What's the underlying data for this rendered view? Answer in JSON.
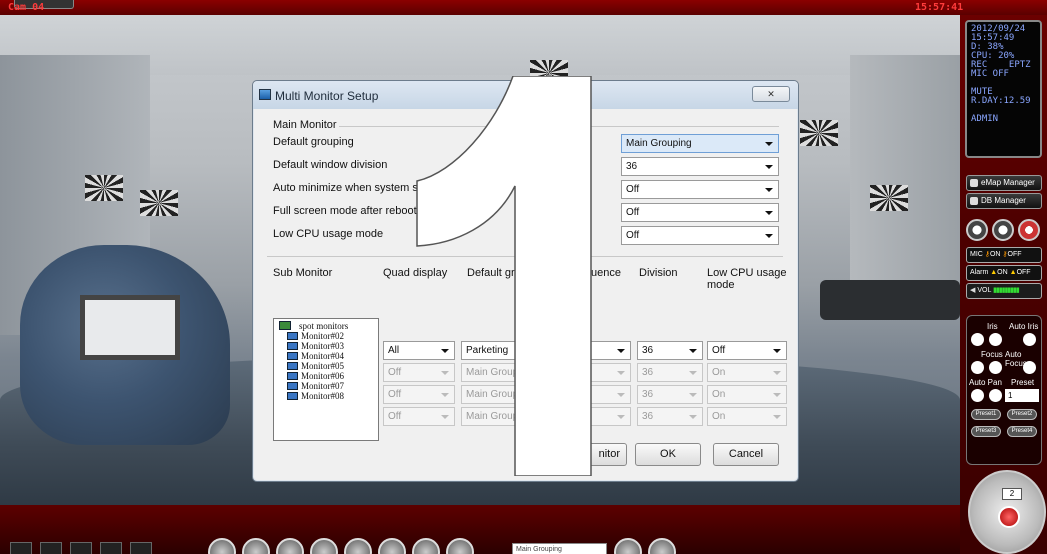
{
  "window": {
    "camera_label": "Cam 04",
    "clock": "15:57:41"
  },
  "status_panel": {
    "lines": [
      "2012/09/24",
      "15:57:49",
      "D: 38%",
      "CPU: 20%",
      "REC    EPTZ",
      "MIC OFF",
      "",
      "MUTE",
      "R.DAY:12.59",
      "",
      "ADMIN"
    ]
  },
  "side_buttons": {
    "emap": "eMap Manager",
    "db": "DB Manager",
    "mic": "MIC",
    "mic_on": "ON",
    "mic_off": "OFF",
    "alarm": "Alarm",
    "alarm_on": "ON",
    "alarm_off": "OFF",
    "vol": "VOL"
  },
  "ptz": {
    "iris": "Iris",
    "auto_iris": "Auto Iris",
    "focus": "Focus",
    "auto_focus": "Auto Focus",
    "auto_pan": "Auto Pan",
    "preset": "Preset",
    "preset_value": "1",
    "preset_buttons": [
      "Preset1",
      "Preset2",
      "Preset3",
      "Preset4"
    ],
    "speed_value": "2"
  },
  "bottom": {
    "select_value": "Main Grouping"
  },
  "dialog": {
    "title": "Multi Monitor Setup",
    "close_glyph": "✕",
    "main_monitor": {
      "heading": "Main Monitor",
      "rows": [
        {
          "label": "Default grouping",
          "value": "Main Grouping"
        },
        {
          "label": "Default window division",
          "value": "36"
        },
        {
          "label": "Auto minimize when system starts",
          "value": "Off"
        },
        {
          "label": "Full screen mode after reboot",
          "value": "Off"
        },
        {
          "label": "Low CPU usage mode",
          "value": "Off"
        }
      ]
    },
    "sub_monitor": {
      "headers": {
        "sub_monitor": "Sub Monitor",
        "quad_display": "Quad display",
        "default_group": "Default grou",
        "sequence": "uence",
        "division": "Division",
        "low_cpu": "Low CPU usage mode"
      },
      "tree": {
        "root": "spot monitors",
        "items": [
          "Monitor#02",
          "Monitor#03",
          "Monitor#04",
          "Monitor#05",
          "Monitor#06",
          "Monitor#07",
          "Monitor#08"
        ]
      },
      "rows": [
        {
          "quad": "All",
          "group": "Parketing",
          "division": "36",
          "low_cpu": "Off"
        },
        {
          "quad": "Off",
          "group": "Main Groupi",
          "division": "36",
          "low_cpu": "On"
        },
        {
          "quad": "Off",
          "group": "Main Groupi",
          "division": "36",
          "low_cpu": "On"
        },
        {
          "quad": "Off",
          "group": "Main Groupi",
          "division": "36",
          "low_cpu": "On"
        }
      ]
    },
    "buttons": {
      "identify": "nitor",
      "ok": "OK",
      "cancel": "Cancel"
    }
  }
}
